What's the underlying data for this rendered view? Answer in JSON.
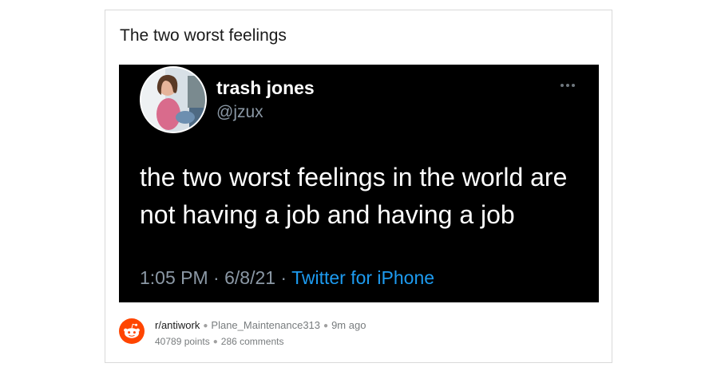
{
  "post": {
    "title": "The two worst feelings"
  },
  "tweet": {
    "name": "trash jones",
    "handle": "@jzux",
    "text": "the two worst feelings in the world are not having a job and having a job",
    "time": "1:05 PM · 6/8/21 · ",
    "source": "Twitter for iPhone",
    "source_color": "#1d9bf0",
    "more_icon": "more-horizontal-icon"
  },
  "footer": {
    "subreddit": "r/antiwork",
    "author": "Plane_Maintenance313",
    "age": "9m ago",
    "points": "40789 points",
    "comments": "286 comments",
    "logo_icon": "reddit-logo-icon",
    "brand_color": "#ff4500"
  }
}
